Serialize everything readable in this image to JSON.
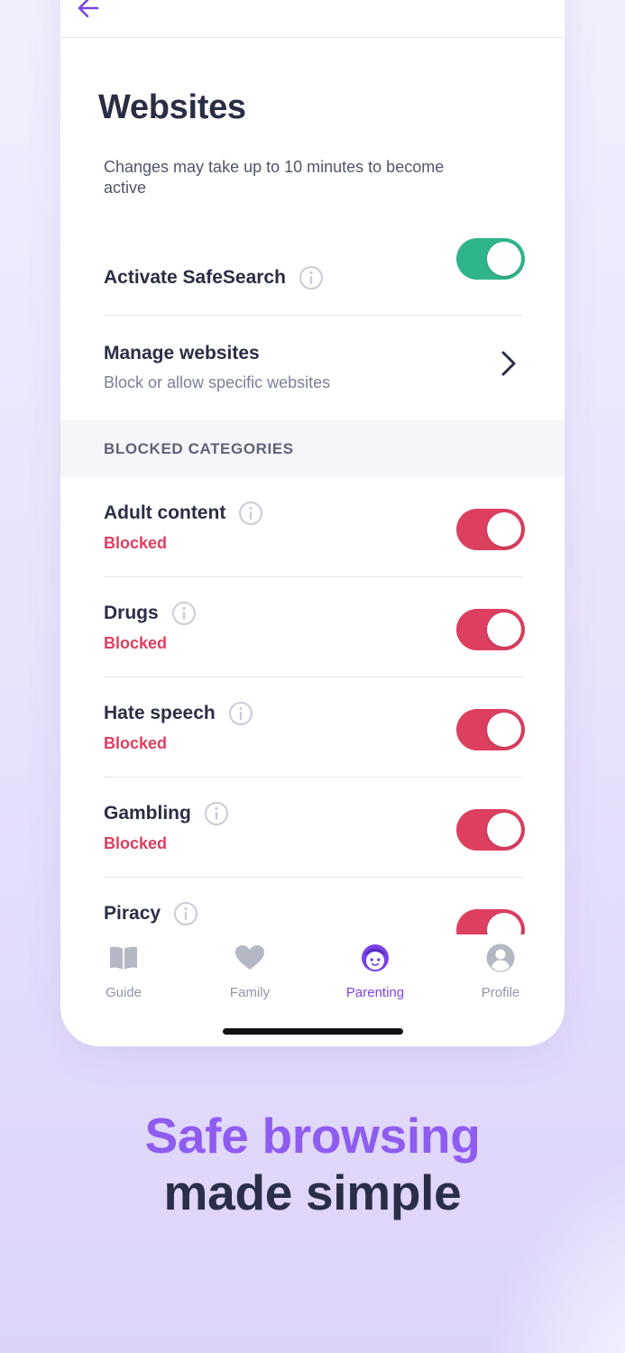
{
  "header": {
    "back_icon": "arrow-left-icon",
    "title": "Websites"
  },
  "note": "Changes may take up to 10 minutes to become active",
  "safesearch": {
    "label": "Activate SafeSearch",
    "info_icon": "info-circle-icon",
    "enabled": true
  },
  "manage": {
    "title": "Manage websites",
    "subtitle": "Block or allow specific websites",
    "chevron_icon": "chevron-right-icon"
  },
  "blocked_section": {
    "header": "BLOCKED CATEGORIES",
    "categories": [
      {
        "name": "Adult content",
        "status": "Blocked",
        "enabled": true
      },
      {
        "name": "Drugs",
        "status": "Blocked",
        "enabled": true
      },
      {
        "name": "Hate speech",
        "status": "Blocked",
        "enabled": true
      },
      {
        "name": "Gambling",
        "status": "Blocked",
        "enabled": true
      },
      {
        "name": "Piracy",
        "status": "",
        "enabled": true
      }
    ]
  },
  "tabs": [
    {
      "label": "Guide",
      "icon": "book-icon",
      "active": false
    },
    {
      "label": "Family",
      "icon": "heart-icon",
      "active": false
    },
    {
      "label": "Parenting",
      "icon": "child-face-icon",
      "active": true
    },
    {
      "label": "Profile",
      "icon": "user-circle-icon",
      "active": false
    }
  ],
  "promo": {
    "line1": "Safe browsing",
    "line2": "made simple"
  },
  "colors": {
    "accent": "#7a43e8",
    "toggle_on_green": "#2fb48c",
    "toggle_on_red": "#dc3f5f",
    "blocked_text": "#dc3f5f",
    "headline_purple": "#8f5cf0",
    "headline_dark": "#2b2e48"
  }
}
